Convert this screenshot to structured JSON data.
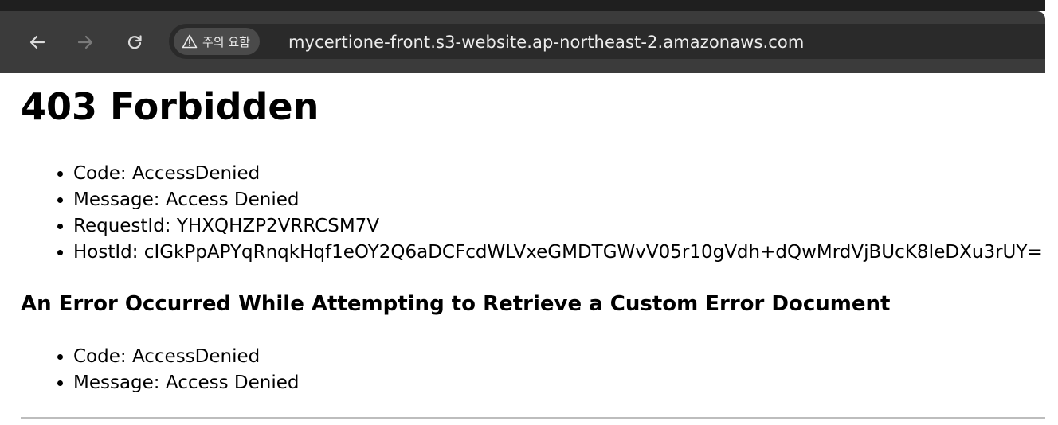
{
  "browser": {
    "security_chip_label": "주의 요함",
    "url": "mycertione-front.s3-website.ap-northeast-2.amazonaws.com",
    "icons": [
      "back-arrow-icon",
      "forward-arrow-icon",
      "reload-icon",
      "warning-icon"
    ]
  },
  "page": {
    "title": "403 Forbidden",
    "details": [
      "Code: AccessDenied",
      "Message: Access Denied",
      "RequestId: YHXQHZP2VRRCSM7V",
      "HostId: cIGkPpAPYqRnqkHqf1eOY2Q6aDCFcdWLVxeGMDTGWvV05r10gVdh+dQwMrdVjBUcK8IeDXu3rUY="
    ],
    "subheading": "An Error Occurred While Attempting to Retrieve a Custom Error Document",
    "sub_details": [
      "Code: AccessDenied",
      "Message: Access Denied"
    ]
  }
}
